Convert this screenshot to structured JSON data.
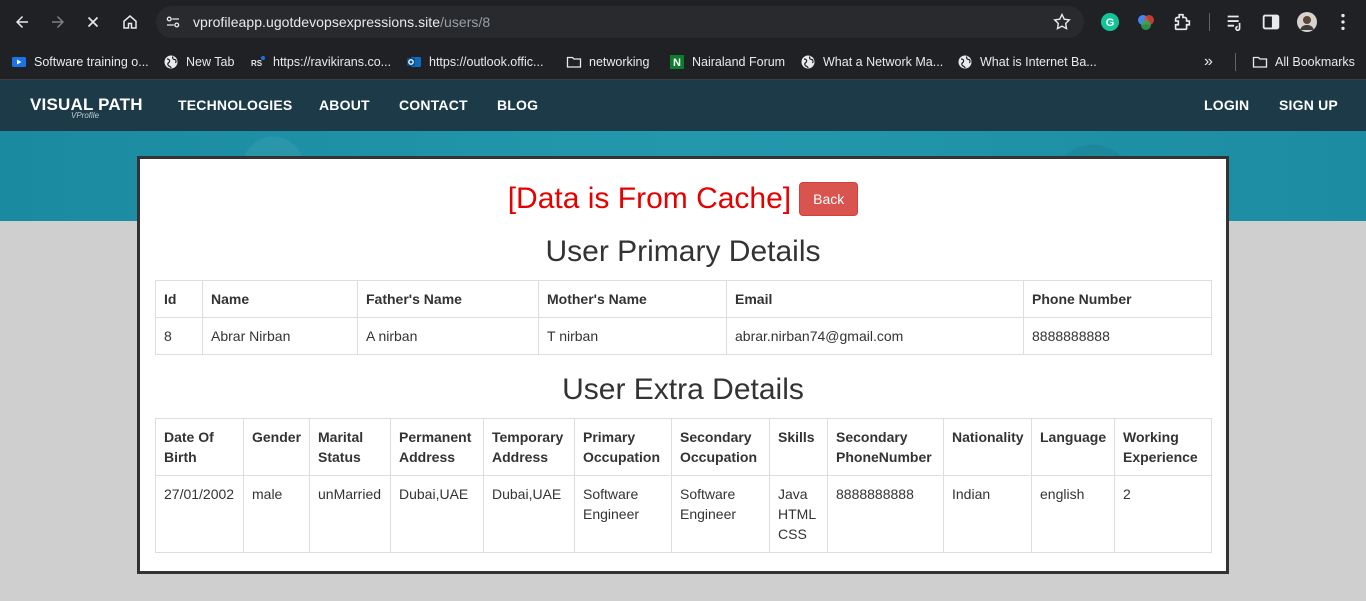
{
  "browser": {
    "url_host": "vprofileapp.ugotdevopsexpressions.site",
    "url_path": "/users/8",
    "bookmarks": [
      {
        "label": "Software training o...",
        "icon": "video-play-icon"
      },
      {
        "label": "New Tab",
        "icon": "globe-icon"
      },
      {
        "label": "https://ravikirans.co...",
        "icon": "rs-logo-icon"
      },
      {
        "label": "https://outlook.offic...",
        "icon": "outlook-icon"
      },
      {
        "label": "networking",
        "icon": "folder-icon"
      },
      {
        "label": "Nairaland Forum",
        "icon": "nairaland-icon"
      },
      {
        "label": "What a Network Ma...",
        "icon": "globe-icon"
      },
      {
        "label": "What is Internet Ba...",
        "icon": "globe-icon"
      }
    ],
    "all_bookmarks": "All Bookmarks",
    "overflow": "»"
  },
  "site": {
    "brand": "VISUAL PATH",
    "brand_sub": "VProfile",
    "nav": [
      "TECHNOLOGIES",
      "ABOUT",
      "CONTACT",
      "BLOG"
    ],
    "login": "LOGIN",
    "signup": "SIGN UP"
  },
  "page": {
    "cache_text": "[Data is From Cache]",
    "back_label": "Back",
    "primary_title": "User Primary Details",
    "extra_title": "User Extra Details"
  },
  "primary": {
    "headers": [
      "Id",
      "Name",
      "Father's Name",
      "Mother's Name",
      "Email",
      "Phone Number"
    ],
    "row": [
      "8",
      "Abrar Nirban",
      "A nirban",
      "T nirban",
      "abrar.nirban74@gmail.com",
      "8888888888"
    ]
  },
  "extra": {
    "headers": [
      [
        "Date Of",
        "Birth"
      ],
      [
        "Gender"
      ],
      [
        "Marital",
        "Status"
      ],
      [
        "Permanent",
        "Address"
      ],
      [
        "Temporary",
        "Address"
      ],
      [
        "Primary",
        "Occupation"
      ],
      [
        "Secondary",
        "Occupation"
      ],
      [
        "Skills"
      ],
      [
        "Secondary",
        "PhoneNumber"
      ],
      [
        "Nationality"
      ],
      [
        "Language"
      ],
      [
        "Working",
        "Experience"
      ]
    ],
    "row": [
      [
        "27/01/2002"
      ],
      [
        "male"
      ],
      [
        "unMarried"
      ],
      [
        "Dubai,UAE"
      ],
      [
        "Dubai,UAE"
      ],
      [
        "Software",
        "Engineer"
      ],
      [
        "Software",
        "Engineer"
      ],
      [
        "Java",
        "HTML",
        "CSS"
      ],
      [
        "8888888888"
      ],
      [
        "Indian"
      ],
      [
        "english"
      ],
      [
        "2"
      ]
    ]
  },
  "colors": {
    "chrome_bg": "#202124",
    "nav_bg": "#1d3a49",
    "hero": "#1e90a6",
    "cache_red": "#e60000",
    "back_btn": "#d9534f"
  }
}
